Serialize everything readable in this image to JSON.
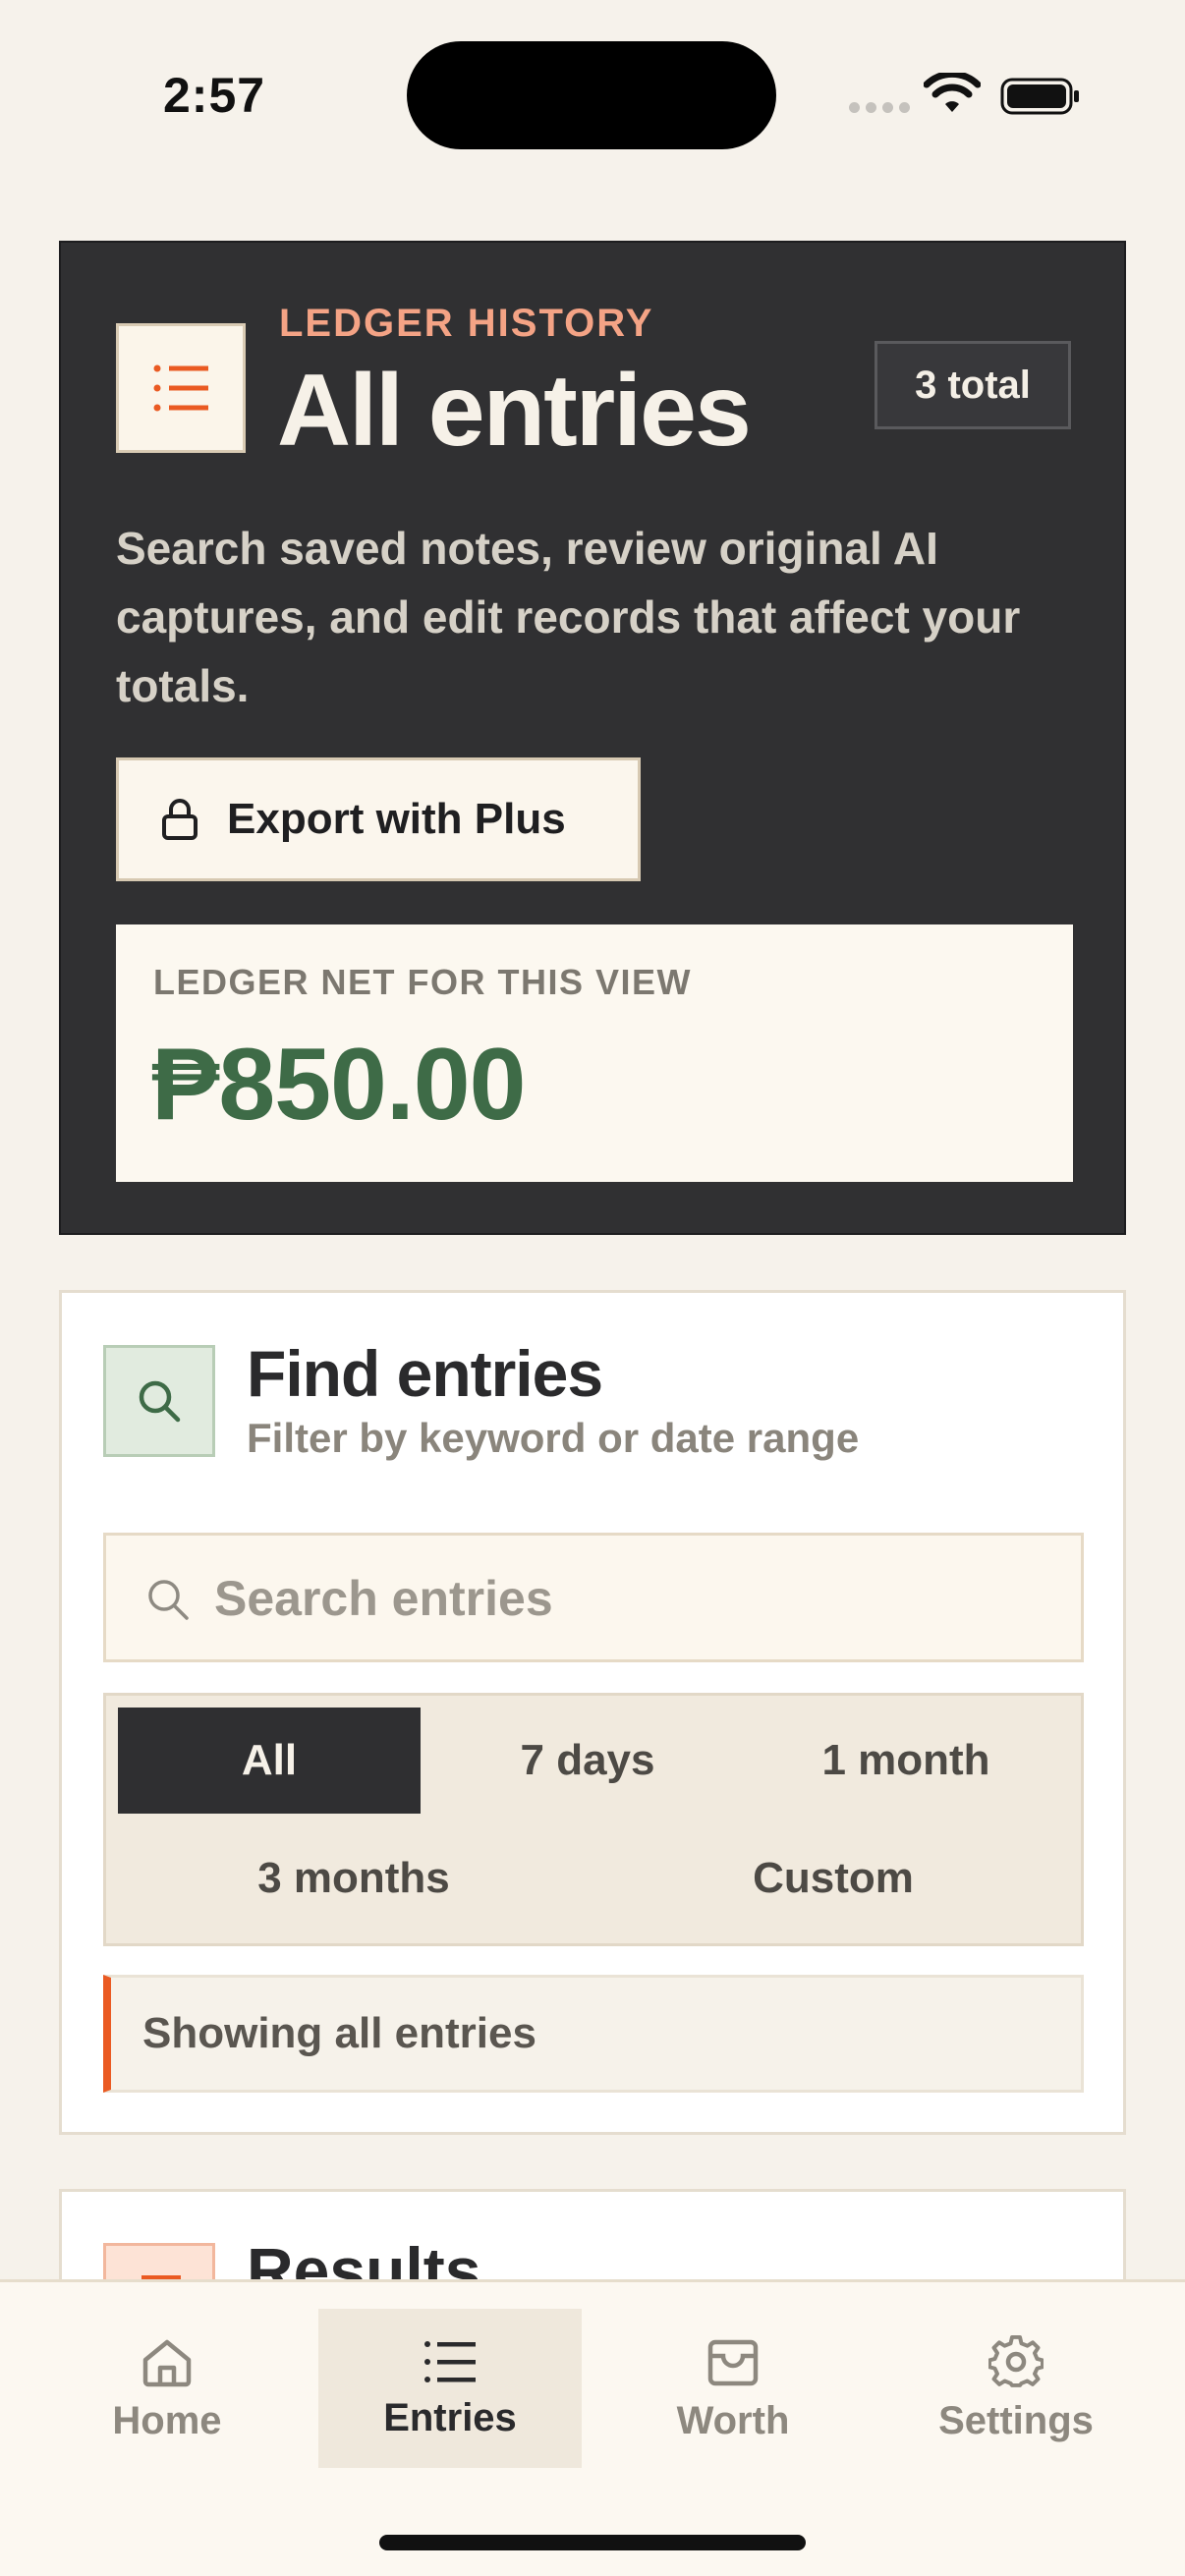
{
  "status_bar": {
    "time": "2:57"
  },
  "hero": {
    "eyebrow": "LEDGER HISTORY",
    "title": "All entries",
    "badge": "3 total",
    "description": "Search saved notes, review original AI captures, and edit records that affect your totals.",
    "export_label": "Export with Plus",
    "net_label": "LEDGER NET FOR THIS VIEW",
    "net_value": "₱850.00"
  },
  "find": {
    "title": "Find entries",
    "subtitle": "Filter by keyword or date range",
    "search_placeholder": "Search entries",
    "ranges": [
      "All",
      "7 days",
      "1 month",
      "3 months",
      "Custom"
    ],
    "selected_range": "All",
    "status_text": "Showing all entries"
  },
  "results": {
    "title": "Results"
  },
  "tabs": [
    {
      "label": "Home",
      "icon": "home-icon"
    },
    {
      "label": "Entries",
      "icon": "list-icon"
    },
    {
      "label": "Worth",
      "icon": "wallet-icon"
    },
    {
      "label": "Settings",
      "icon": "gear-icon"
    }
  ],
  "active_tab": "Entries",
  "colors": {
    "background": "#f6f2eb",
    "hero_dark": "#303032",
    "accent_orange": "#ea5a22",
    "eyebrow_salmon": "#f4a385",
    "money_green": "#3e6b47"
  }
}
